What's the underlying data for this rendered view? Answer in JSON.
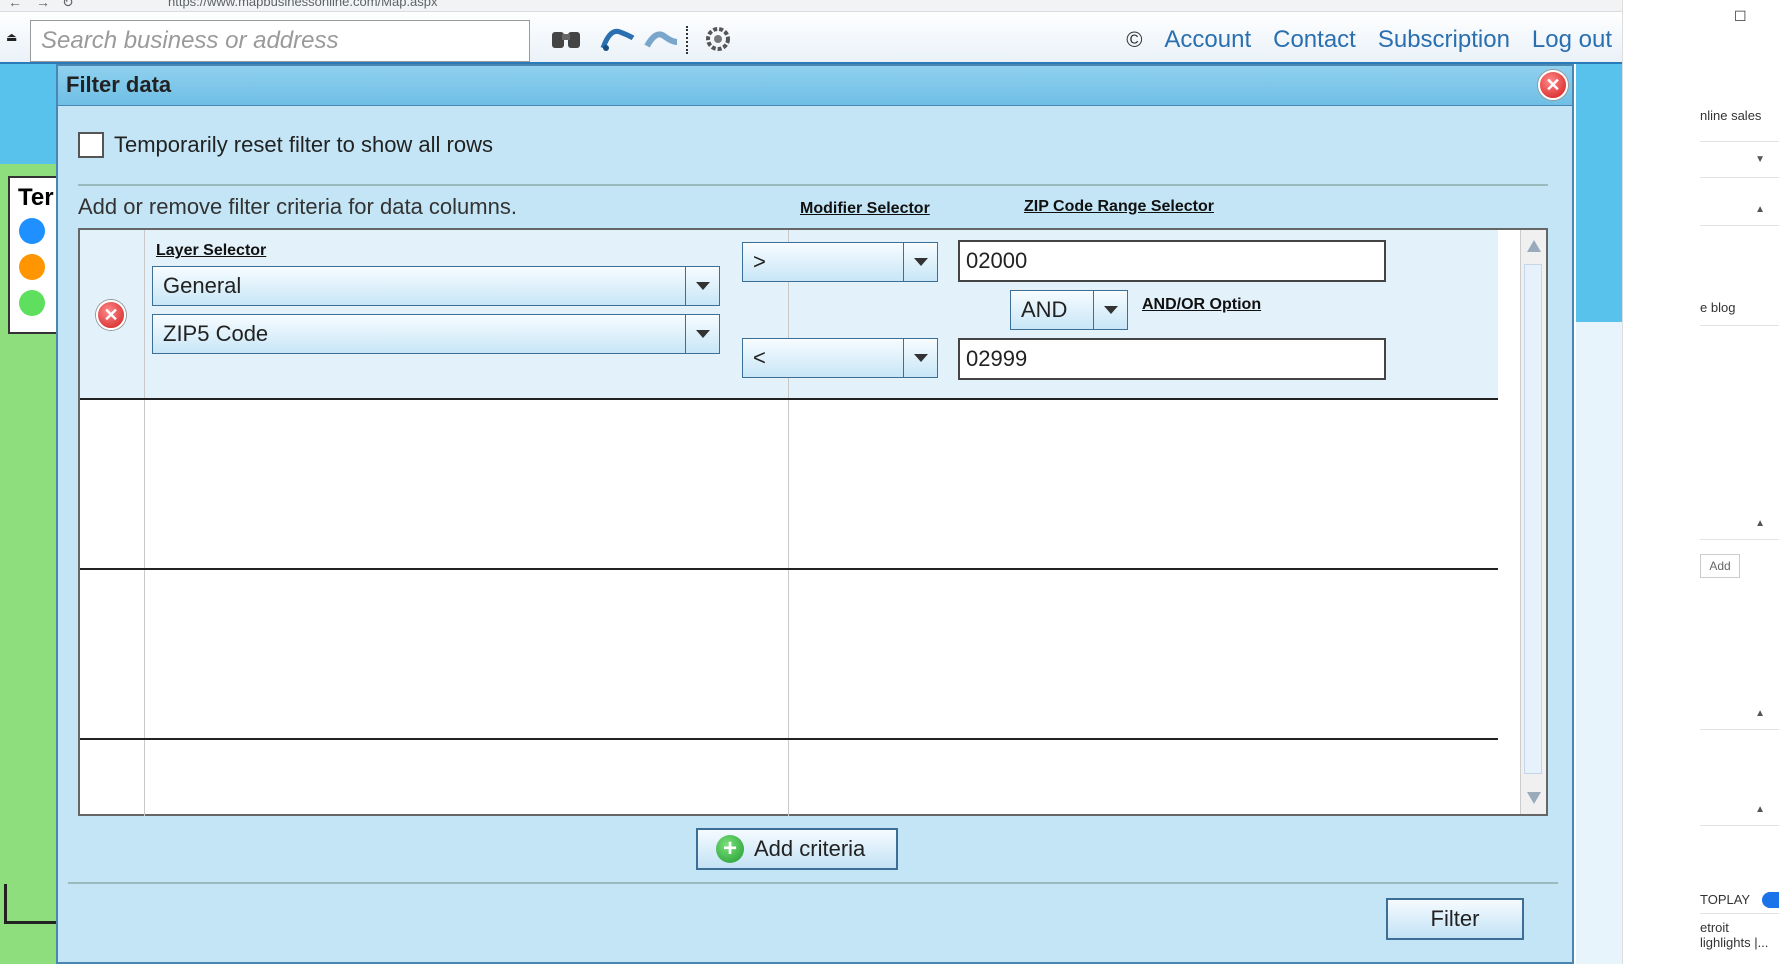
{
  "browser": {
    "url": "https://www.mapbusinessonline.com/Map.aspx"
  },
  "toolbar": {
    "search_placeholder": "Search business or address",
    "icons": [
      "binoculars-icon",
      "route-icon",
      "map-icon",
      "gear-icon"
    ]
  },
  "top_links": {
    "copyright_symbol": "©",
    "account": "Account",
    "contact": "Contact",
    "subscription": "Subscription",
    "logout": "Log out"
  },
  "map_panel": {
    "title_fragment": "Ter"
  },
  "side_panel": {
    "online_sales": "nline sales",
    "blog": "e blog",
    "add": "Add",
    "autoplay": "TOPLAY",
    "news_line1": "etroit",
    "news_line2": "lighlights |..."
  },
  "dialog": {
    "title": "Filter data",
    "reset_label": "Temporarily reset filter to show all rows",
    "criteria_instructions": "Add or remove filter criteria for data columns.",
    "modifier_header": "Modifier Selector",
    "zip_range_header": "ZIP Code Range Selector",
    "layer_selector_label": "Layer Selector",
    "andor_label": "AND/OR Option",
    "criteria": [
      {
        "layer": "General",
        "column": "ZIP5 Code",
        "modifier1": ">",
        "value1": "02000",
        "andor": "AND",
        "modifier2": "<",
        "value2": "02999"
      }
    ],
    "add_criteria_label": "Add criteria",
    "filter_label": "Filter"
  },
  "colors": {
    "dialog_bg": "#c3e5f6",
    "link": "#2a6fb0",
    "legend_dots": [
      "#1e90ff",
      "#ff9500",
      "#5ee05e"
    ]
  }
}
